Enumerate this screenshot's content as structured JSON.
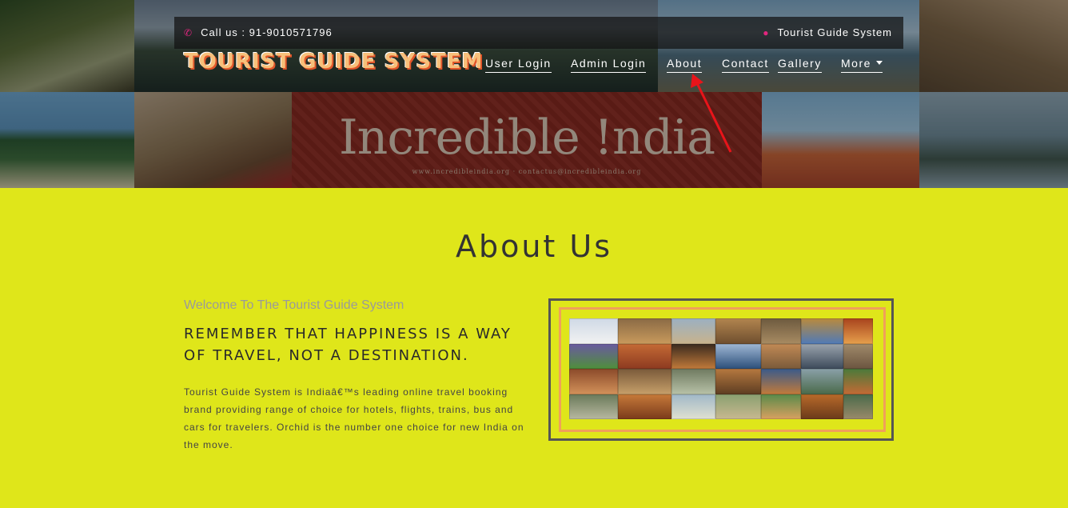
{
  "topbar": {
    "phone_icon": "phone-icon",
    "call_text": "Call us : 91-9010571796",
    "location_icon": "map-marker-icon",
    "brand_text": "Tourist Guide System"
  },
  "logo": "TOURIST GUIDE SYSTEM",
  "nav": {
    "items": [
      {
        "label": "User Login"
      },
      {
        "label": "Admin Login"
      },
      {
        "label": "About"
      },
      {
        "label": "Contact"
      },
      {
        "label": "Gallery"
      },
      {
        "label": "More"
      }
    ]
  },
  "banner": {
    "text": "Incredible !ndia",
    "subtext": "www.incredibleindia.org · contactus@incredibleindia.org"
  },
  "about": {
    "title": "About Us",
    "welcome": "Welcome To The Tourist Guide System",
    "headline": "REMEMBER THAT HAPPINESS IS A WAY OF TRAVEL, NOT A DESTINATION.",
    "paragraph": "Tourist Guide System is Indiaâ€™s leading online travel booking brand providing range of choice for hotels, flights, trains, bus and cars for travelers. Orchid is the number one choice for new India on the move."
  },
  "colors": {
    "page_bg": "#dfe61a",
    "accent_pink": "#e0267e",
    "frame_orange": "#f0a05a",
    "arrow_red": "#e8141a"
  }
}
